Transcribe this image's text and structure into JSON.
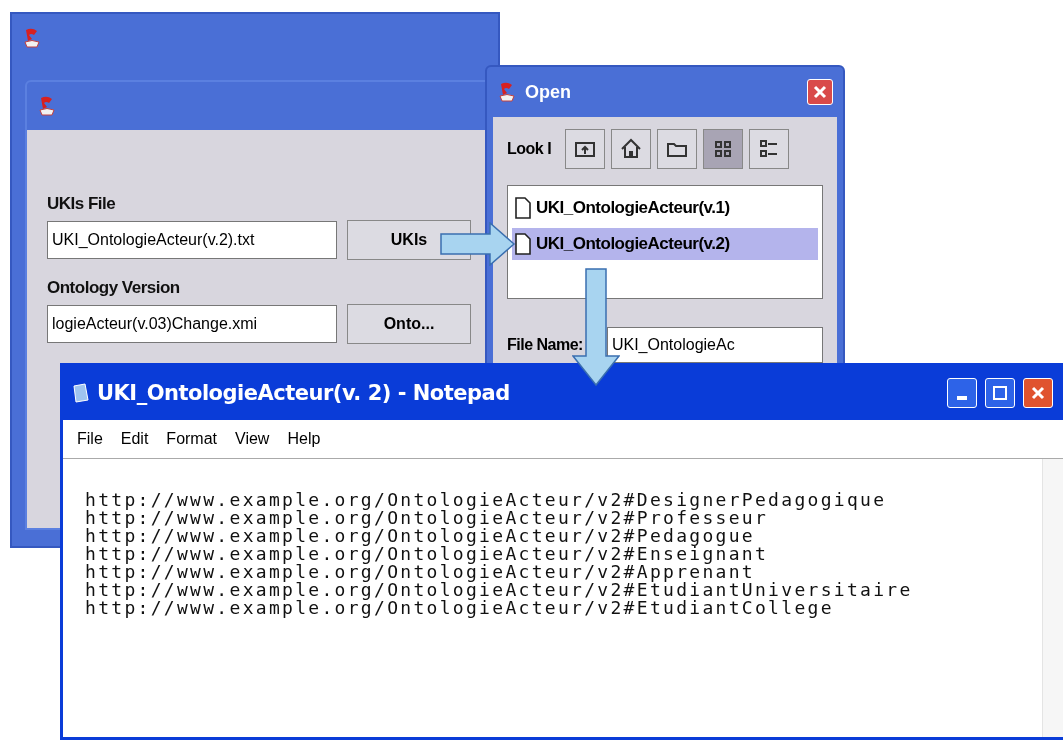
{
  "dialog": {
    "fields": [
      {
        "label": "UKIs File",
        "value": "UKI_OntologieActeur(v.2).txt",
        "button": "UKIs"
      },
      {
        "label": "Ontology Version",
        "value": "logieActeur(v.03)Change.xmi",
        "button": "Onto..."
      }
    ]
  },
  "open_dialog": {
    "title": "Open",
    "look_in_label": "Look I",
    "toolbar": [
      {
        "kind": "up",
        "selected": false
      },
      {
        "kind": "home",
        "selected": false
      },
      {
        "kind": "folder",
        "selected": false
      },
      {
        "kind": "list",
        "selected": true
      },
      {
        "kind": "details",
        "selected": false
      }
    ],
    "files": [
      {
        "name": "UKI_OntologieActeur(v.1)",
        "selected": false
      },
      {
        "name": "UKI_OntologieActeur(v.2)",
        "selected": true
      }
    ],
    "file_name_label": "File Name:",
    "file_name_value": "UKI_OntologieAc"
  },
  "notepad": {
    "title": "UKI_OntologieActeur(v. 2) - Notepad",
    "menu": [
      "File",
      "Edit",
      "Format",
      "View",
      "Help"
    ],
    "lines": [
      "http://www.example.org/OntologieActeur/v2#DesignerPedagogique",
      "http://www.example.org/OntologieActeur/v2#Professeur",
      "http://www.example.org/OntologieActeur/v2#Pedagogue",
      "http://www.example.org/OntologieActeur/v2#Enseignant",
      "http://www.example.org/OntologieActeur/v2#Apprenant",
      "http://www.example.org/OntologieActeur/v2#EtudiantUniversitaire",
      "http://www.example.org/OntologieActeur/v2#EtudiantCollege"
    ]
  }
}
